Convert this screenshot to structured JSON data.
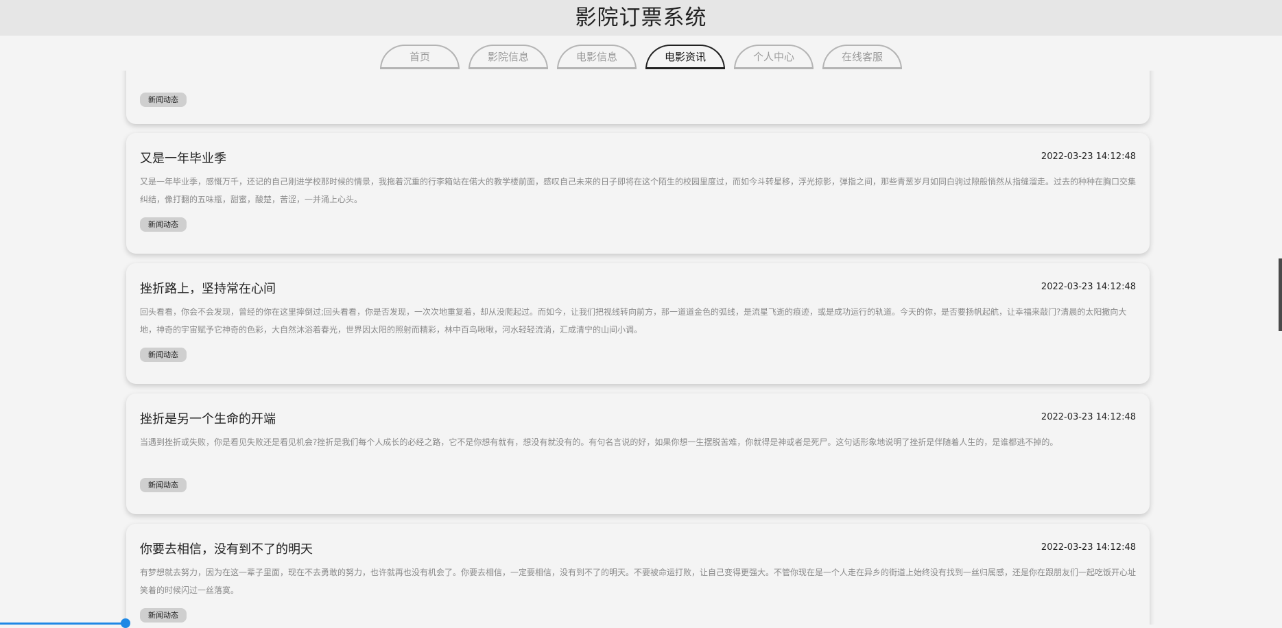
{
  "header": {
    "title": "影院订票系统"
  },
  "nav": {
    "tabs": [
      {
        "label": "首页"
      },
      {
        "label": "影院信息"
      },
      {
        "label": "电影信息"
      },
      {
        "label": "电影资讯"
      },
      {
        "label": "个人中心"
      },
      {
        "label": "在线客服"
      }
    ],
    "active_tab": "电影资讯"
  },
  "news": {
    "tag_label": "新闻动态",
    "articles": [
      {
        "title": "又是一年毕业季",
        "date": "2022-03-23 14:12:48",
        "summary": "又是一年毕业季，感慨万千，还记的自己刚进学校那时候的情景，我拖着沉重的行李箱站在偌大的教学楼前面，感叹自己未来的日子即将在这个陌生的校园里度过，而如今斗转星移，浮光掠影，弹指之间，那些青葱岁月如同白驹过隙般悄然从指缝溜走。过去的种种在胸口交集纠结，像打翻的五味瓶，甜蜜，酸楚，苦涩，一并涌上心头。",
        "tag": "新闻动态"
      },
      {
        "title": "挫折路上，坚持常在心间",
        "date": "2022-03-23 14:12:48",
        "summary": "回头看看，你会不会发现，曾经的你在这里摔倒过;回头看看，你是否发现，一次次地重复着，却从没爬起过。而如今，让我们把视线转向前方，那一道道金色的弧线，是流星飞逝的痕迹，或是成功运行的轨道。今天的你，是否要扬帆起航，让幸福来敲门?清晨的太阳撒向大地，神奇的宇宙赋予它神奇的色彩，大自然沐浴着春光，世界因太阳的照射而精彩，林中百鸟啾啾，河水轻轻流淌，汇成清宁的山间小调。",
        "tag": "新闻动态"
      },
      {
        "title": "挫折是另一个生命的开端",
        "date": "2022-03-23 14:12:48",
        "summary": "当遇到挫折或失败，你是看见失败还是看见机会?挫折是我们每个人成长的必经之路，它不是你想有就有，想没有就没有的。有句名言说的好，如果你想一生摆脱苦难，你就得是神或者是死尸。这句话形象地说明了挫折是伴随着人生的，是谁都逃不掉的。",
        "tag": "新闻动态"
      },
      {
        "title": "你要去相信，没有到不了的明天",
        "date": "2022-03-23 14:12:48",
        "summary": "有梦想就去努力，因为在这一辈子里面，现在不去勇敢的努力，也许就再也没有机会了。你要去相信，一定要相信，没有到不了的明天。不要被命运打败，让自己变得更强大。不管你现在是一个人走在异乡的街道上始终没有找到一丝归属感，还是你在跟朋友们一起吃饭开心址笑着的时候闪过一丝落寞。",
        "tag": "新闻动态"
      }
    ]
  }
}
